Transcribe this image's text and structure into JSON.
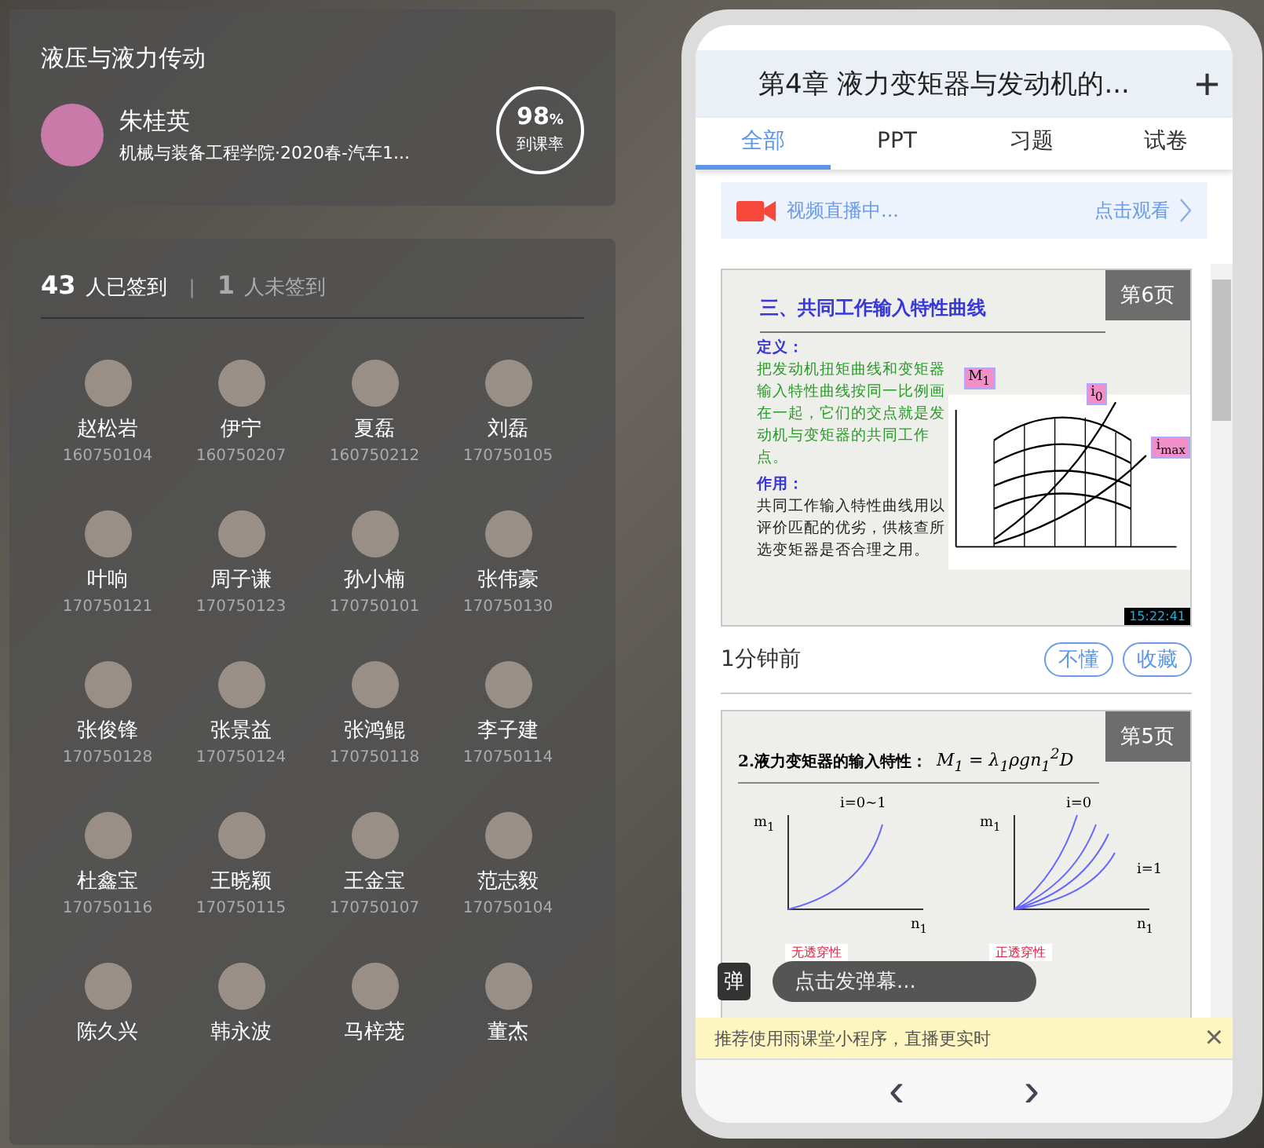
{
  "course": {
    "title": "液压与液力传动",
    "teacher": "朱桂英",
    "class_info": "机械与装备工程学院·2020春-汽车1...",
    "rate": {
      "value": "98",
      "unit": "%",
      "label": "到课率"
    }
  },
  "attendance": {
    "signed_count": "43",
    "signed_label": "人已签到",
    "separator": "|",
    "unsigned_count": "1",
    "unsigned_label": "人未签到",
    "students": [
      {
        "name": "赵松岩",
        "id": "160750104"
      },
      {
        "name": "伊宁",
        "id": "160750207"
      },
      {
        "name": "夏磊",
        "id": "160750212"
      },
      {
        "name": "刘磊",
        "id": "170750105"
      },
      {
        "name": "叶响",
        "id": "170750121"
      },
      {
        "name": "周子谦",
        "id": "170750123"
      },
      {
        "name": "孙小楠",
        "id": "170750101"
      },
      {
        "name": "张伟豪",
        "id": "170750130"
      },
      {
        "name": "张俊锋",
        "id": "170750128"
      },
      {
        "name": "张景益",
        "id": "170750124"
      },
      {
        "name": "张鸿鲲",
        "id": "170750118"
      },
      {
        "name": "李子建",
        "id": "170750114"
      },
      {
        "name": "杜鑫宝",
        "id": "170750116"
      },
      {
        "name": "王晓颖",
        "id": "170750115"
      },
      {
        "name": "王金宝",
        "id": "170750107"
      },
      {
        "name": "范志毅",
        "id": "170750104"
      },
      {
        "name": "陈久兴"
      },
      {
        "name": "韩永波"
      },
      {
        "name": "马梓茏"
      },
      {
        "name": "董杰"
      }
    ]
  },
  "phone": {
    "header_title": "第4章 液力变矩器与发动机的...",
    "add_icon": "+",
    "tabs": [
      {
        "label": "全部",
        "selected": true
      },
      {
        "label": "PPT",
        "selected": false
      },
      {
        "label": "习题",
        "selected": false
      },
      {
        "label": "试卷",
        "selected": false
      }
    ],
    "live_banner": {
      "text": "视频直播中...",
      "action": "点击观看"
    },
    "slides": [
      {
        "kind": "curve",
        "page": "第6页",
        "title": "三、共同工作输入特性曲线",
        "def_heading": "定义：",
        "def_text": "把发动机扭矩曲线和变矩器输入特性曲线按同一比例画在一起，它们的交点就是发动机与变矩器的共同工作点。",
        "use_heading": "作用：",
        "use_text": "共同工作输入特性曲线用以评价匹配的优劣，供核查所选变矩器是否合理之用。",
        "chart_labels": [
          "M$_{1}$",
          "i$_{0}$",
          "i$_{max}$"
        ],
        "clock": "15:22:41",
        "time": "1分钟前",
        "buttons": [
          "不懂",
          "收藏"
        ]
      },
      {
        "kind": "input",
        "page": "第5页",
        "title": "2.液力变矩器的输入特性：",
        "formula": "M$_{1}$ = λ$_{1}$ρgn$_{1}$$^{2}$D",
        "left_labels": [
          "m$_{1}$",
          "i=0~1",
          "n$_{1}$"
        ],
        "right_labels": [
          "m$_{1}$",
          "i=0",
          "i=1",
          "n$_{1}$"
        ],
        "notes": [
          "无透穿性",
          "正透穿性"
        ]
      }
    ],
    "danmaku": {
      "badge": "弹",
      "placeholder": "点击发弹幕..."
    },
    "tip": {
      "text": "推荐使用雨课堂小程序，直播更实时",
      "close": "×"
    },
    "nav": {
      "prev": "‹",
      "next": "›"
    }
  }
}
